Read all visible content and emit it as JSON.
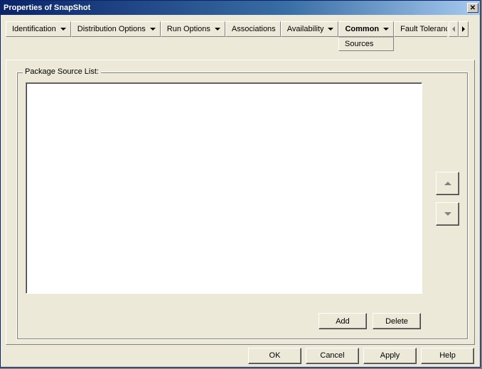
{
  "window": {
    "title": "Properties of SnapShot",
    "close_glyph": "✕"
  },
  "tabs": {
    "identification": "Identification",
    "distribution_options": "Distribution Options",
    "run_options": "Run Options",
    "associations": "Associations",
    "availability": "Availability",
    "common": "Common",
    "fault_tolerance": "Fault Toleranc",
    "common_submenu": "Sources"
  },
  "group": {
    "label": "Package Source List:"
  },
  "list_actions": {
    "add": "Add",
    "delete": "Delete"
  },
  "commands": {
    "ok": "OK",
    "cancel": "Cancel",
    "apply": "Apply",
    "help": "Help"
  }
}
